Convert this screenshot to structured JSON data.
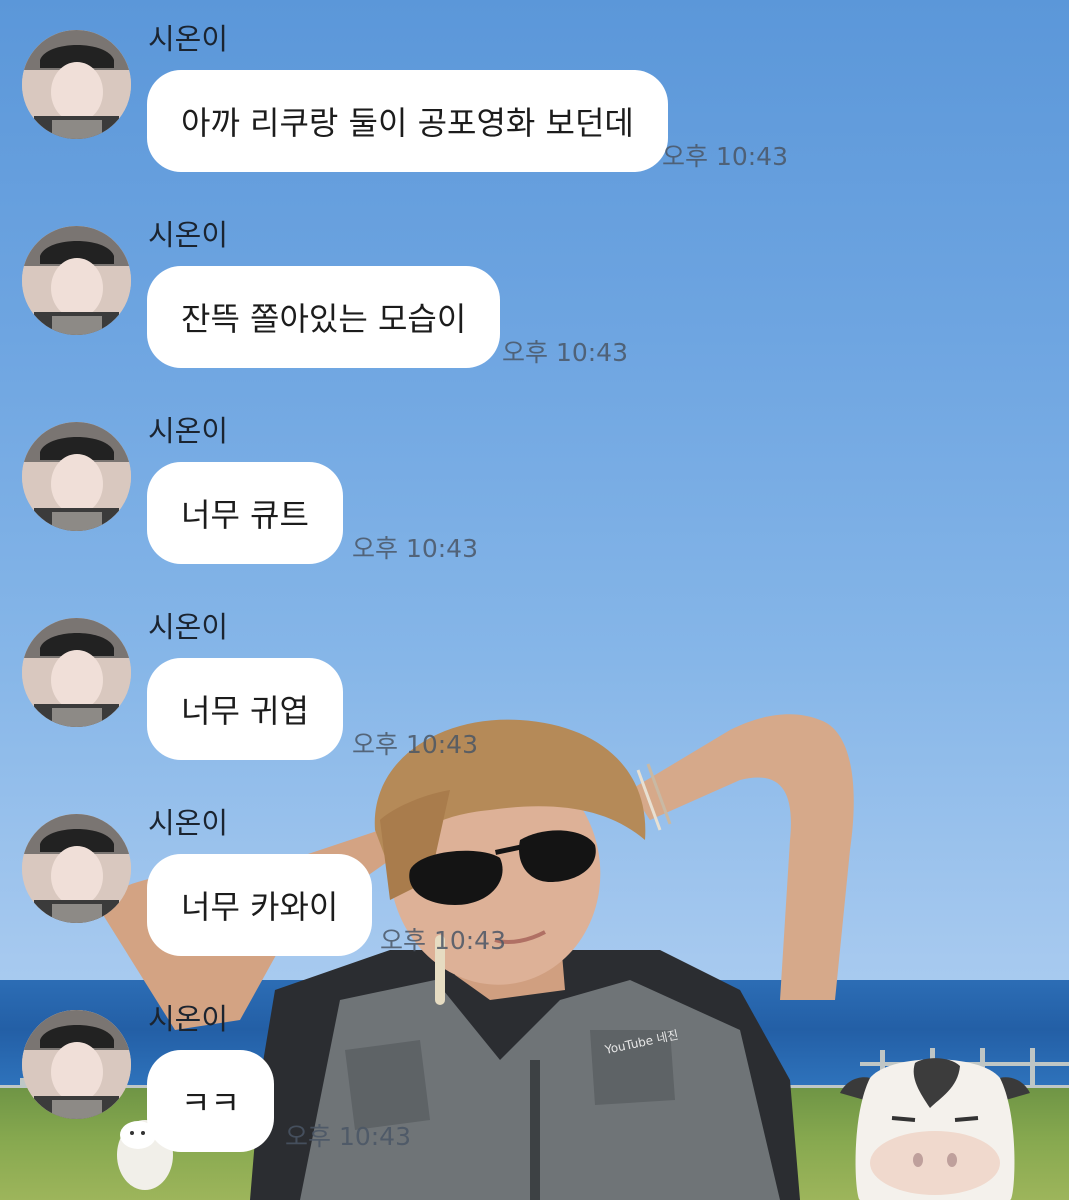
{
  "chat": {
    "messages": [
      {
        "sender": "시온이",
        "text": "아까 리쿠랑 둘이 공포영화 보던데",
        "time": "오후 10:43"
      },
      {
        "sender": "시온이",
        "text": "잔뜩 쫄아있는 모습이",
        "time": "오후 10:43"
      },
      {
        "sender": "시온이",
        "text": "너무 큐트",
        "time": "오후 10:43"
      },
      {
        "sender": "시온이",
        "text": "너무 귀엽",
        "time": "오후 10:43"
      },
      {
        "sender": "시온이",
        "text": "너무 카와이",
        "time": "오후 10:43"
      },
      {
        "sender": "시온이",
        "text": "ㅋㅋ",
        "time": "오후 10:43"
      }
    ]
  },
  "wallpaper": {
    "watermark": "YouTube 네진"
  },
  "colors": {
    "sky_top": "#5b97d9",
    "sky_bottom": "#b3d1f1",
    "bubble": "#ffffff",
    "timestamp": "#4a5665"
  }
}
